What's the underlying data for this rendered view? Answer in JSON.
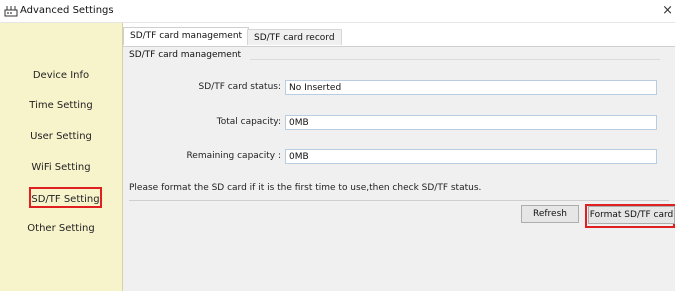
{
  "window": {
    "title": "Advanced Settings",
    "close_symbol": "×",
    "app_icon": "router-icon"
  },
  "sidebar": {
    "items": [
      {
        "label": "Device Info",
        "active": false
      },
      {
        "label": "Time Setting",
        "active": false
      },
      {
        "label": "User Setting",
        "active": false
      },
      {
        "label": "WiFi Setting",
        "active": false
      },
      {
        "label": "SD/TF Setting",
        "active": true
      },
      {
        "label": "Other Setting",
        "active": false
      }
    ]
  },
  "tabs": [
    {
      "label": "SD/TF card management",
      "active": true
    },
    {
      "label": "SD/TF card record",
      "active": false
    }
  ],
  "section": {
    "title": "SD/TF card management",
    "fields": [
      {
        "label": "SD/TF card status:",
        "value": "No Inserted"
      },
      {
        "label": "Total capacity:",
        "value": "0MB"
      },
      {
        "label": "Remaining capacity :",
        "value": "0MB"
      }
    ],
    "note": "Please format the SD card if it is the first time to use,then check SD/TF status."
  },
  "buttons": {
    "refresh": "Refresh",
    "format": "Format SD/TF card"
  },
  "colors": {
    "sidebar_bg": "#f7f4cc",
    "highlight": "#e02020",
    "content_bg": "#f0f0f0"
  }
}
